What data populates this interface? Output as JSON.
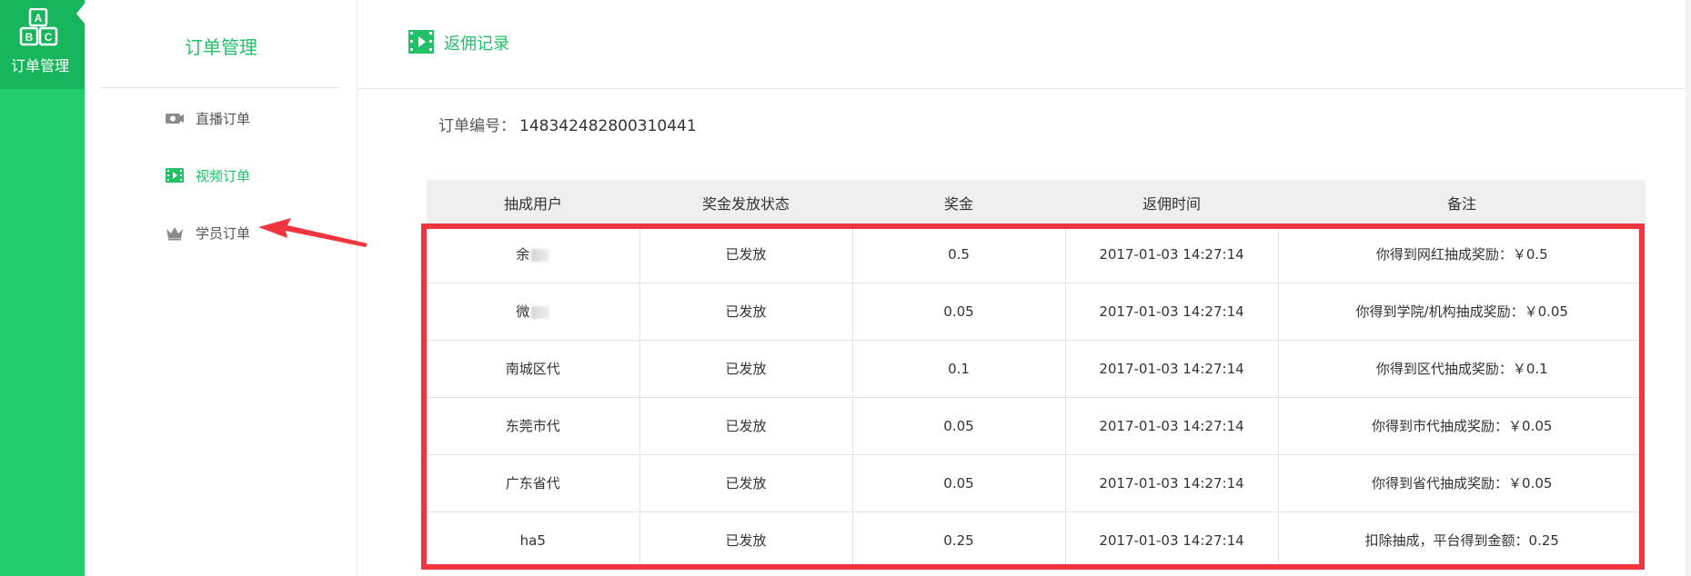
{
  "rail": {
    "label": "订单管理",
    "logo_letters": [
      "A",
      "B",
      "C"
    ],
    "icon": "abc-blocks-icon",
    "bg_color": "#21cd6c"
  },
  "sidebar": {
    "title": "订单管理",
    "items": [
      {
        "label": "直播订单",
        "icon": "camera-icon",
        "active": false
      },
      {
        "label": "视频订单",
        "icon": "video-film-icon",
        "active": true
      },
      {
        "label": "学员订单",
        "icon": "crown-icon",
        "active": false
      }
    ]
  },
  "topbar": {
    "title": "返佣记录",
    "icon": "video-film-icon"
  },
  "order": {
    "label": "订单编号：",
    "number": "148342482800310441"
  },
  "table": {
    "headers": [
      "抽成用户",
      "奖金发放状态",
      "奖金",
      "返佣时间",
      "备注"
    ],
    "rows": [
      {
        "user": "余",
        "status": "已发放",
        "amount": "0.5",
        "time": "2017-01-03 14:27:14",
        "note": "你得到网红抽成奖励：￥0.5",
        "user_blurred": true
      },
      {
        "user": "微",
        "status": "已发放",
        "amount": "0.05",
        "time": "2017-01-03 14:27:14",
        "note": "你得到学院/机构抽成奖励：￥0.05",
        "user_blurred": true
      },
      {
        "user": "南城区代",
        "status": "已发放",
        "amount": "0.1",
        "time": "2017-01-03 14:27:14",
        "note": "你得到区代抽成奖励：￥0.1",
        "user_blurred": false
      },
      {
        "user": "东莞市代",
        "status": "已发放",
        "amount": "0.05",
        "time": "2017-01-03 14:27:14",
        "note": "你得到市代抽成奖励：￥0.05",
        "user_blurred": false
      },
      {
        "user": "广东省代",
        "status": "已发放",
        "amount": "0.05",
        "time": "2017-01-03 14:27:14",
        "note": "你得到省代抽成奖励：￥0.05",
        "user_blurred": false
      },
      {
        "user": "ha5",
        "status": "已发放",
        "amount": "0.25",
        "time": "2017-01-03 14:27:14",
        "note": "扣除抽成，平台得到金额：0.25",
        "user_blurred": false
      }
    ]
  },
  "colors": {
    "accent": "#21c16a",
    "highlight_box": "#f0353f",
    "arrow": "#f0353f"
  }
}
